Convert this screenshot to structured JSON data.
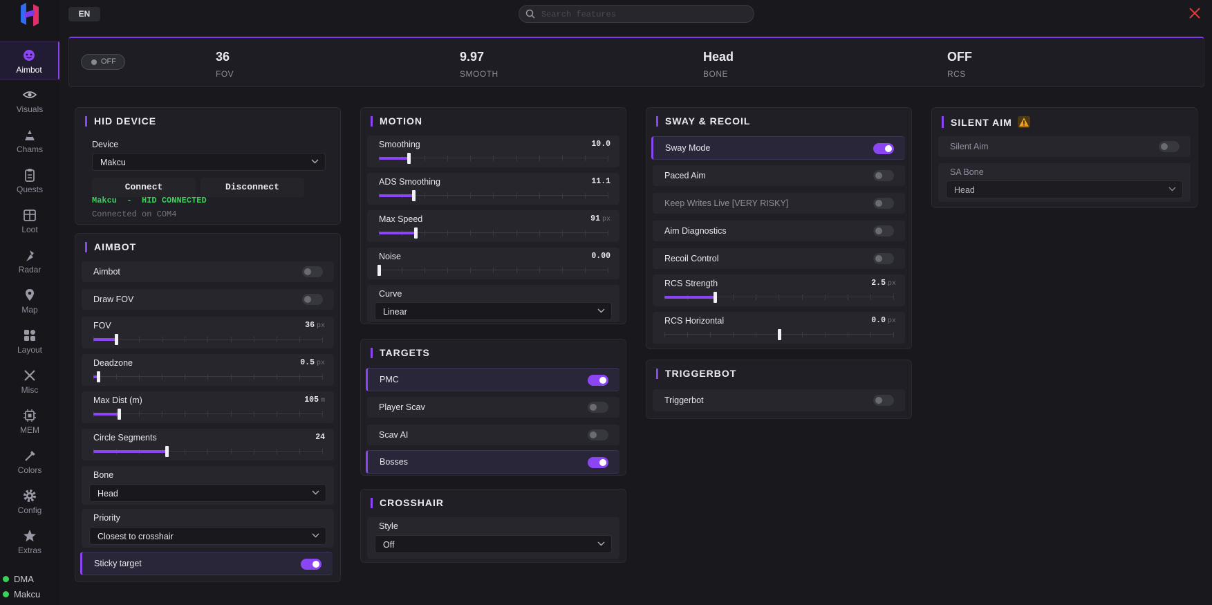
{
  "app": {
    "language": "EN",
    "search_placeholder": "Search features"
  },
  "sidebar": {
    "items": [
      {
        "label": "Aimbot",
        "icon": "aimbot-face-icon",
        "active": true
      },
      {
        "label": "Visuals",
        "icon": "eye-icon"
      },
      {
        "label": "Chams",
        "icon": "chams-icon"
      },
      {
        "label": "Quests",
        "icon": "clipboard-icon"
      },
      {
        "label": "Loot",
        "icon": "box-icon"
      },
      {
        "label": "Radar",
        "icon": "radar-icon"
      },
      {
        "label": "Map",
        "icon": "map-pin-icon"
      },
      {
        "label": "Layout",
        "icon": "layout-icon"
      },
      {
        "label": "Misc",
        "icon": "tools-icon"
      },
      {
        "label": "MEM",
        "icon": "chip-icon"
      },
      {
        "label": "Colors",
        "icon": "brush-icon"
      },
      {
        "label": "Config",
        "icon": "gear-icon"
      },
      {
        "label": "Extras",
        "icon": "star-icon"
      }
    ],
    "status": [
      {
        "label": "DMA",
        "color": "#3ad15a"
      },
      {
        "label": "Makcu",
        "color": "#3ad15a"
      }
    ]
  },
  "stats": {
    "toggle_label": "OFF",
    "items": [
      {
        "value": "36",
        "key": "FOV"
      },
      {
        "value": "9.97",
        "key": "SMOOTH"
      },
      {
        "value": "Head",
        "key": "BONE"
      },
      {
        "value": "OFF",
        "key": "RCS"
      }
    ]
  },
  "hid": {
    "title": "HID DEVICE",
    "device_label": "Device",
    "device_value": "Makcu",
    "connect": "Connect",
    "disconnect": "Disconnect",
    "status_device": "Makcu",
    "status_sep": "-",
    "status_text": "HID CONNECTED",
    "port_text": "Connected on COM4"
  },
  "aimbot": {
    "title": "AIMBOT",
    "aimbot_label": "Aimbot",
    "aimbot_on": false,
    "drawfov_label": "Draw FOV",
    "drawfov_on": false,
    "fov": {
      "label": "FOV",
      "value": "36",
      "unit": "px",
      "fraction": 0.1
    },
    "deadzone": {
      "label": "Deadzone",
      "value": "0.5",
      "unit": "px",
      "fraction": 0.02
    },
    "maxdist": {
      "label": "Max Dist (m)",
      "value": "105",
      "unit": "m",
      "fraction": 0.11
    },
    "segments": {
      "label": "Circle Segments",
      "value": "24",
      "fraction": 0.32
    },
    "bone": {
      "label": "Bone",
      "value": "Head"
    },
    "priority": {
      "label": "Priority",
      "value": "Closest to crosshair"
    },
    "sticky_label": "Sticky target",
    "sticky_on": true
  },
  "motion": {
    "title": "MOTION",
    "smoothing": {
      "label": "Smoothing",
      "value": "10.0",
      "fraction": 0.13
    },
    "ads": {
      "label": "ADS Smoothing",
      "value": "11.1",
      "fraction": 0.15
    },
    "maxspeed": {
      "label": "Max Speed",
      "value": "91",
      "unit": "px",
      "fraction": 0.16
    },
    "noise": {
      "label": "Noise",
      "value": "0.00",
      "fraction": 0.0
    },
    "curve": {
      "label": "Curve",
      "value": "Linear"
    }
  },
  "targets": {
    "title": "TARGETS",
    "items": [
      {
        "label": "PMC",
        "on": true
      },
      {
        "label": "Player Scav",
        "on": false
      },
      {
        "label": "Scav AI",
        "on": false
      },
      {
        "label": "Bosses",
        "on": true
      }
    ]
  },
  "crosshair": {
    "title": "CROSSHAIR",
    "style_label": "Style",
    "style_value": "Off"
  },
  "sway": {
    "title": "SWAY & RECOIL",
    "sway_label": "Sway Mode",
    "sway_on": true,
    "paced_label": "Paced Aim",
    "paced_on": false,
    "keep_label": "Keep Writes Live [VERY RISKY]",
    "keep_on": false,
    "diag_label": "Aim Diagnostics",
    "diag_on": false,
    "recoil_label": "Recoil Control",
    "recoil_on": false,
    "rcs": {
      "label": "RCS Strength",
      "value": "2.5",
      "unit": "px",
      "fraction": 0.22
    },
    "rcsh": {
      "label": "RCS Horizontal",
      "value": "0.0",
      "unit": "px",
      "fraction": 0.5
    }
  },
  "trigger": {
    "title": "TRIGGERBOT",
    "label": "Triggerbot",
    "on": false
  },
  "silent": {
    "title": "SILENT AIM",
    "label": "Silent Aim",
    "on": false,
    "bone_label": "SA Bone",
    "bone_value": "Head"
  },
  "colors": {
    "accent": "#8b45f2",
    "background": "#18181d",
    "connected": "#3ad15a"
  }
}
